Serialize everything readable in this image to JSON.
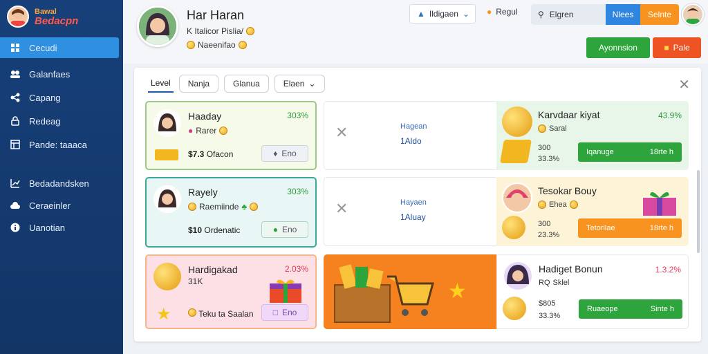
{
  "sidebar": {
    "logo_line1": "Bawal",
    "logo_line2": "Bedacpn",
    "items": [
      {
        "label": "Cecudi",
        "icon": "grid-icon",
        "active": true
      },
      {
        "label": "Galanfaes",
        "icon": "people-icon"
      },
      {
        "label": "Capang",
        "icon": "share-icon"
      },
      {
        "label": "Redeag",
        "icon": "lock-icon"
      },
      {
        "label": "Pande: taaaca",
        "icon": "dashboard-icon"
      },
      {
        "label": "Bedadandsken",
        "icon": "chart-icon"
      },
      {
        "label": "Ceraeinler",
        "icon": "cloud-icon"
      },
      {
        "label": "Uanotian",
        "icon": "info-icon"
      }
    ]
  },
  "header": {
    "name": "Har Haran",
    "line1": "K Italicor Pislia/",
    "line2": "Naeenifao",
    "dropdown_label": "Ildigaen",
    "regional_label": "Regul",
    "search_placeholder": "Elgren",
    "btn_blue": "Nlees",
    "btn_orange": "Selnte",
    "btn_green": "Ayonnsion",
    "btn_red": "Pale"
  },
  "tabs": [
    {
      "label": "Level",
      "active": true
    },
    {
      "label": "Nanja"
    },
    {
      "label": "Glanua"
    },
    {
      "label": "Elaen",
      "dropdown": true
    }
  ],
  "cards": [
    {
      "name": "Haaday",
      "pct": "303%",
      "sub": "Rarer",
      "amount": "$7.3",
      "amount_label": "Ofacon",
      "btn": "Eno"
    },
    {
      "name": "Rayely",
      "pct": "303%",
      "sub": "Raemiinde",
      "amount": "$10",
      "amount_label": "Ordenatic",
      "btn": "Eno"
    },
    {
      "name": "Hardigakad",
      "pct": "2.03%",
      "sub": "31K",
      "amount_label": "Teku ta Saalan",
      "btn": "Eno"
    }
  ],
  "middles": [
    {
      "line1": "Hagean",
      "line2": "1Aldo"
    },
    {
      "line1": "Hayaen",
      "line2": "1Aluay"
    }
  ],
  "right_cards": [
    {
      "name": "Karvdaar kiyat",
      "pct": "43.9%",
      "sub": "Saral",
      "v1": "300",
      "v2": "33.3%",
      "btn_left": "Iqanuge",
      "btn_right": "18rte h",
      "color": "#2ea43d"
    },
    {
      "name": "Tesokar Bouy",
      "pct": "",
      "sub": "Ehea",
      "v1": "300",
      "v2": "23.3%",
      "btn_left": "Tetorilae",
      "btn_right": "18rte h",
      "color": "#f7931e"
    },
    {
      "name": "Hadiget Bonun",
      "pct": "1.3.2%",
      "sub": "Sklel",
      "prefix": "RQ",
      "v1": "$805",
      "v2": "33.3%",
      "btn_left": "Ruaeope",
      "btn_right": "Sinte h",
      "color": "#2ea43d"
    }
  ]
}
